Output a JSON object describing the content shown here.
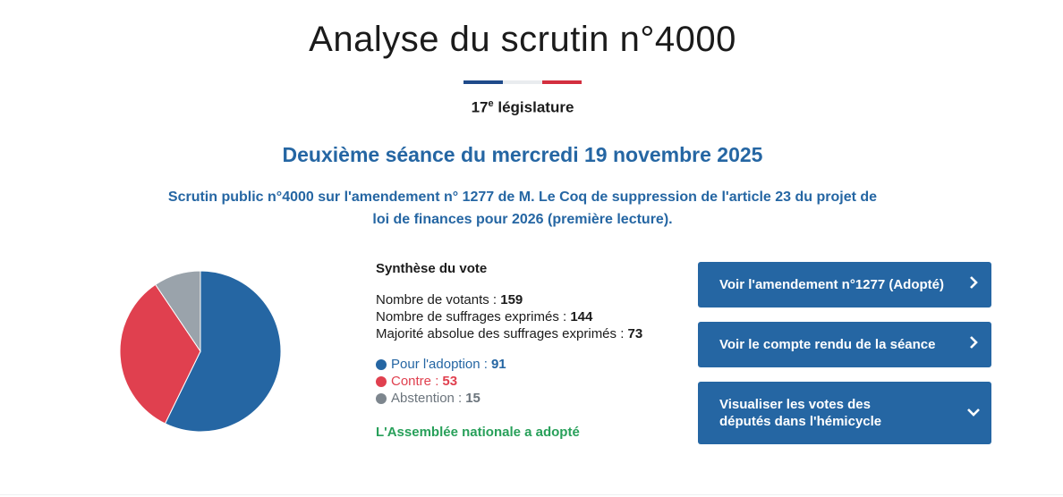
{
  "header": {
    "title": "Analyse du scrutin n°4000",
    "legislature_num": "17",
    "legislature_sup": "e",
    "legislature_text": " législature"
  },
  "seance": "Deuxième séance du mercredi 19 novembre 2025",
  "description": "Scrutin public n°4000 sur l'amendement n° 1277 de M. Le Coq de suppression de l'article 23 du projet de loi de finances pour 2026 (première lecture).",
  "synthese": {
    "heading": "Synthèse du vote",
    "votants_label": "Nombre de votants : ",
    "votants": "159",
    "exprimes_label": "Nombre de suffrages exprimés : ",
    "exprimes": "144",
    "majorite_label": "Majorité absolue des suffrages exprimés : ",
    "majorite": "73",
    "pour_label": "Pour l'adoption : ",
    "pour": "91",
    "contre_label": "Contre : ",
    "contre": "53",
    "abstention_label": "Abstention : ",
    "abstention": "15",
    "result": "L'Assemblée nationale a adopté"
  },
  "colors": {
    "pour": "#2566a3",
    "contre": "#e0404f",
    "abstention": "#9aa3ab",
    "accent": "#2566a3",
    "adopted": "#28a05a"
  },
  "chart_data": {
    "type": "pie",
    "categories": [
      "Pour l'adoption",
      "Contre",
      "Abstention"
    ],
    "values": [
      91,
      53,
      15
    ]
  },
  "buttons": {
    "amendement": "Voir l'amendement n°1277 (Adopté)",
    "compte_rendu": "Voir le compte rendu de la séance",
    "hemicycle": "Visualiser les votes des députés dans l'hémicycle"
  },
  "icons": {
    "amendement": "chevron-right-icon",
    "compte_rendu": "chevron-right-icon",
    "hemicycle": "chevron-down-icon"
  }
}
